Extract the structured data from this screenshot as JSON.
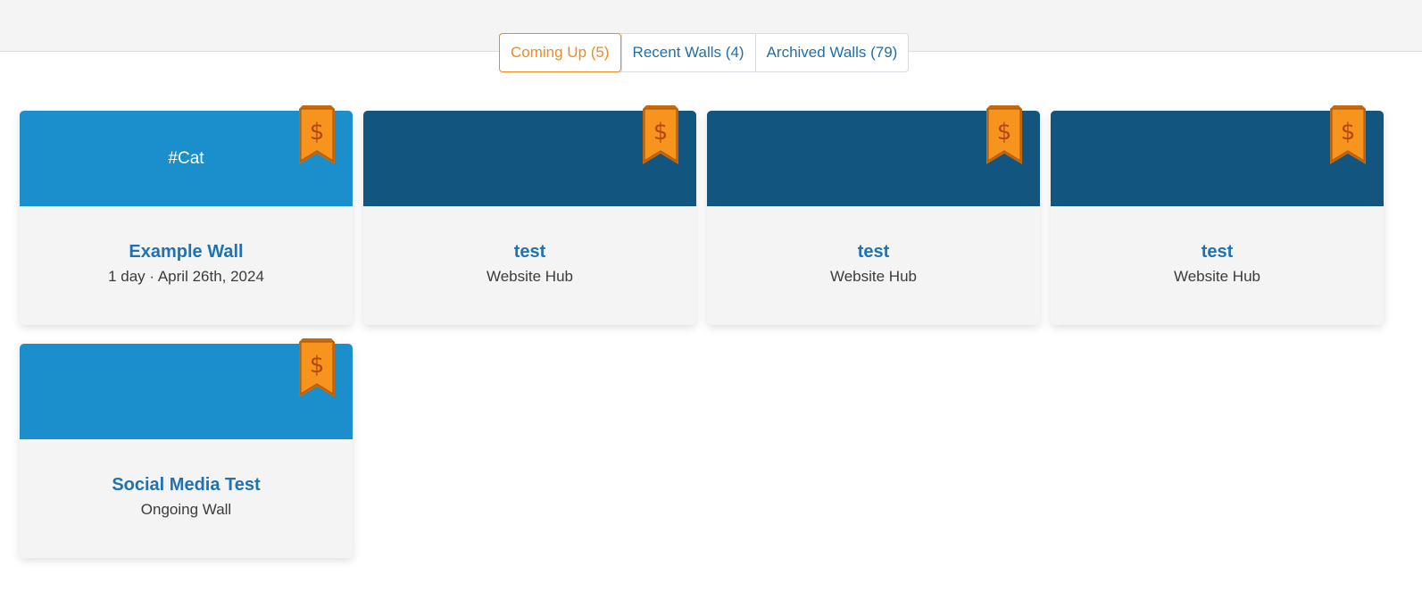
{
  "tabs": [
    {
      "label": "Coming Up (5)",
      "active": true
    },
    {
      "label": "Recent Walls (4)",
      "active": false
    },
    {
      "label": "Archived Walls (79)",
      "active": false
    }
  ],
  "cards": [
    {
      "header_text": "#Cat",
      "header_color": "#1b8fcc",
      "title": "Example Wall",
      "subtitle": "1 day · April 26th, 2024",
      "badge_symbol": "$"
    },
    {
      "header_text": "",
      "header_color": "#12557f",
      "title": "test",
      "subtitle": "Website Hub",
      "badge_symbol": "$"
    },
    {
      "header_text": "",
      "header_color": "#12557f",
      "title": "test",
      "subtitle": "Website Hub",
      "badge_symbol": "$"
    },
    {
      "header_text": "",
      "header_color": "#12557f",
      "title": "test",
      "subtitle": "Website Hub",
      "badge_symbol": "$"
    },
    {
      "header_text": "",
      "header_color": "#1b8fcc",
      "title": "Social Media Test",
      "subtitle": "Ongoing Wall",
      "badge_symbol": "$"
    }
  ],
  "colors": {
    "accent_orange": "#ee8a1f",
    "link_blue": "#1f6fae",
    "ribbon_fill": "#f7941d",
    "ribbon_symbol": "#b5460f"
  },
  "icons": {
    "badge": "premium-dollar-ribbon-icon"
  }
}
